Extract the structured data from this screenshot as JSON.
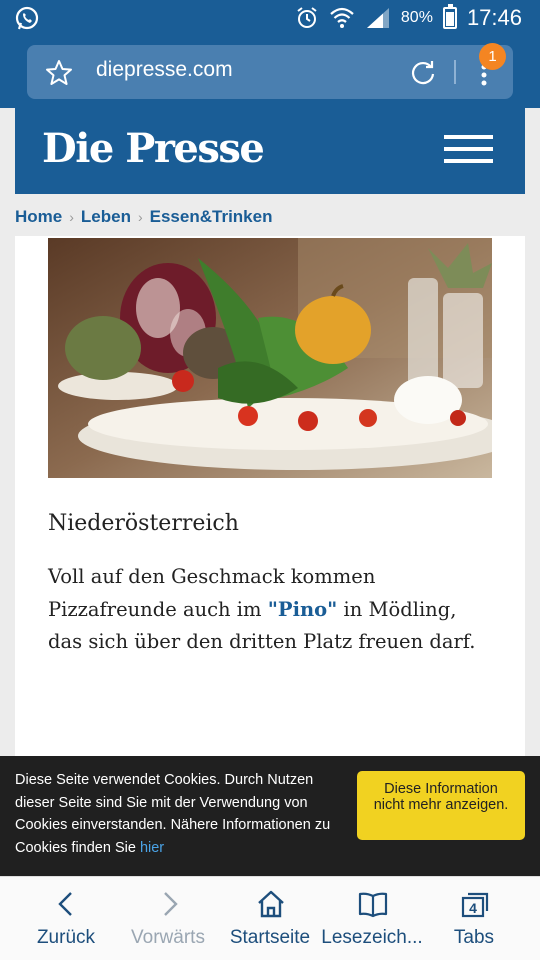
{
  "status_bar": {
    "battery_percent": "80%",
    "time": "17:46",
    "icons": [
      "whatsapp-icon",
      "alarm-icon",
      "wifi-icon",
      "signal-icon",
      "battery-icon"
    ]
  },
  "browser": {
    "url": "diepresse.com",
    "menu_badge": "1",
    "icons": [
      "star-icon",
      "reload-icon",
      "overflow-menu-icon"
    ]
  },
  "site": {
    "logo": "Die Presse"
  },
  "breadcrumb": {
    "items": [
      "Home",
      "Leben",
      "Essen&Trinken"
    ]
  },
  "article": {
    "subtitle": "Niederösterreich",
    "body_before": "Voll auf den Geschmack kommen Pizzafreunde auch im ",
    "body_link": "\"Pino\"",
    "body_after": " in Mödling, das sich über den dritten Platz freuen darf."
  },
  "cookie_banner": {
    "text": "Diese Seite verwendet Cookies. Durch Nutzen dieser Seite sind Sie mit der Verwendung von Cookies einverstanden. Nähere Informationen zu Cookies finden Sie ",
    "link": "hier",
    "button": "Diese Information nicht mehr anzeigen."
  },
  "bottom_nav": {
    "back": "Zurück",
    "forward": "Vorwärts",
    "home": "Startseite",
    "bookmarks": "Lesezeich...",
    "tabs": "Tabs",
    "tab_count": "4"
  },
  "colors": {
    "brand_blue": "#1a5d96",
    "badge_orange": "#f48522",
    "cookie_button_yellow": "#f1d221",
    "link_blue": "#4aa3e6"
  }
}
